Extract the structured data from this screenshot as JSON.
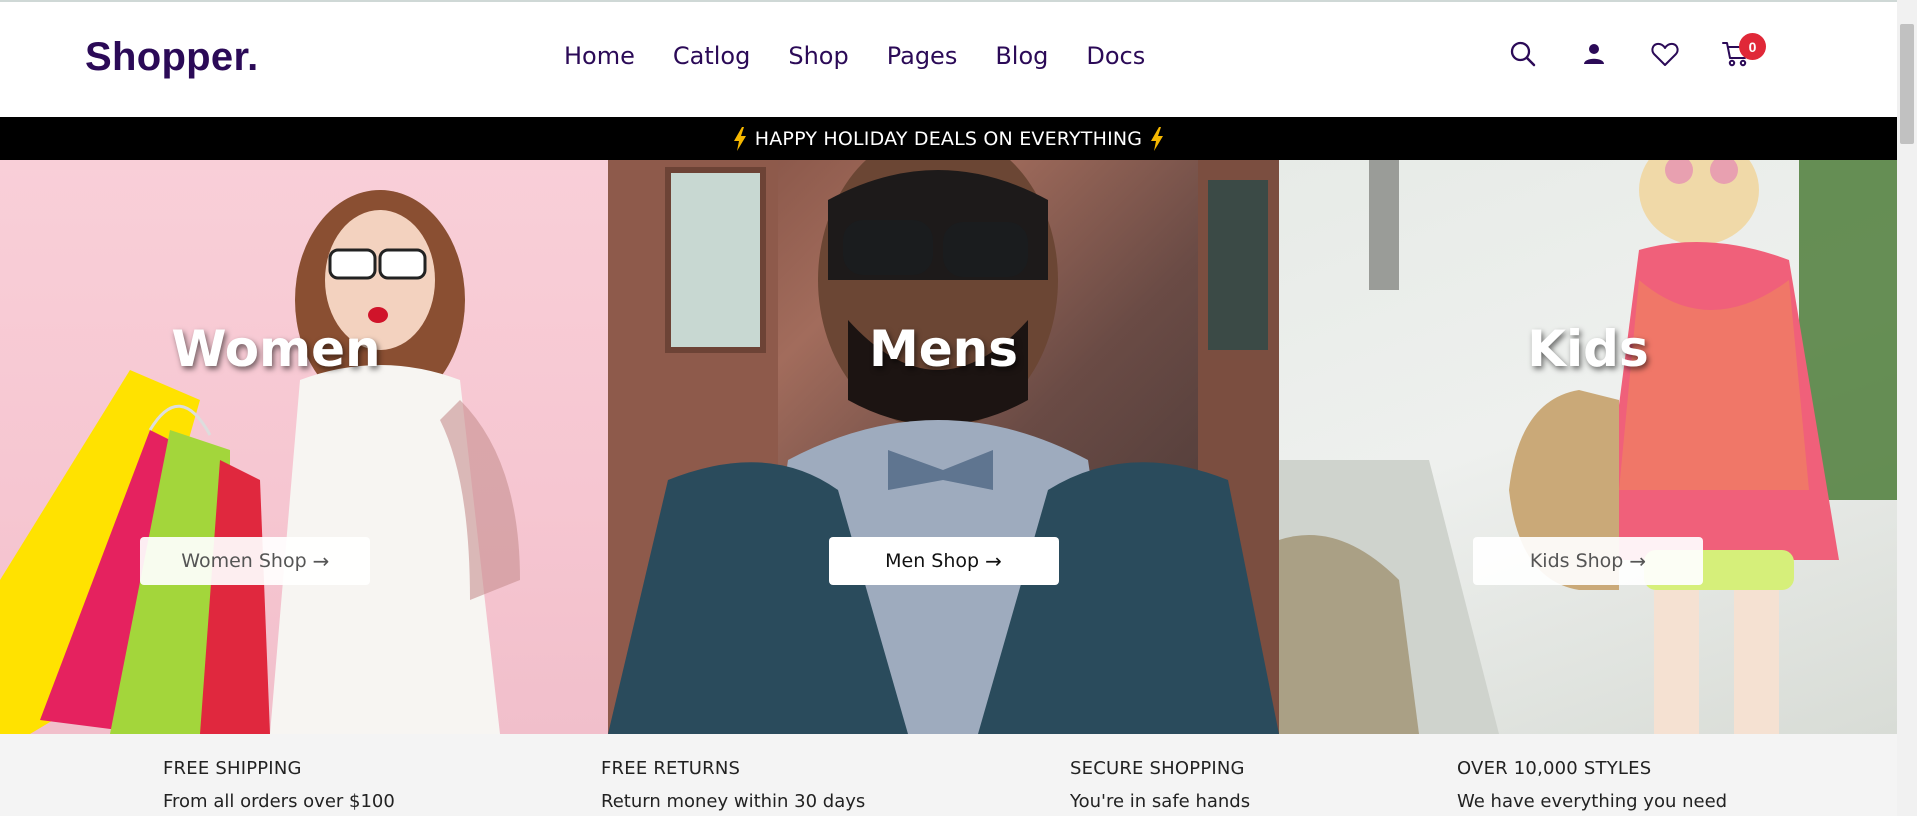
{
  "header": {
    "logo": "Shopper.",
    "nav": [
      "Home",
      "Catlog",
      "Shop",
      "Pages",
      "Blog",
      "Docs"
    ],
    "icons": [
      "search-icon",
      "user-icon",
      "heart-icon",
      "cart-icon"
    ],
    "cart_count": "0"
  },
  "promo": {
    "text": "HAPPY HOLIDAY DEALS ON EVERYTHING",
    "icon": "lightning-icon",
    "icon_color": "#f5b700"
  },
  "hero": [
    {
      "title": "Women",
      "button": "Women Shop"
    },
    {
      "title": "Mens",
      "button": "Men Shop"
    },
    {
      "title": "Kids",
      "button": "Kids Shop"
    }
  ],
  "features": [
    {
      "title": "FREE SHIPPING",
      "sub": "From all orders over $100"
    },
    {
      "title": "FREE RETURNS",
      "sub": "Return money within 30 days"
    },
    {
      "title": "SECURE SHOPPING",
      "sub": "You're in safe hands"
    },
    {
      "title": "OVER 10,000 STYLES",
      "sub": "We have everything you need"
    }
  ],
  "colors": {
    "brand": "#2b0a57",
    "badge": "#e02838",
    "promo_bg": "#000000",
    "features_bg": "#f4f4f4"
  }
}
